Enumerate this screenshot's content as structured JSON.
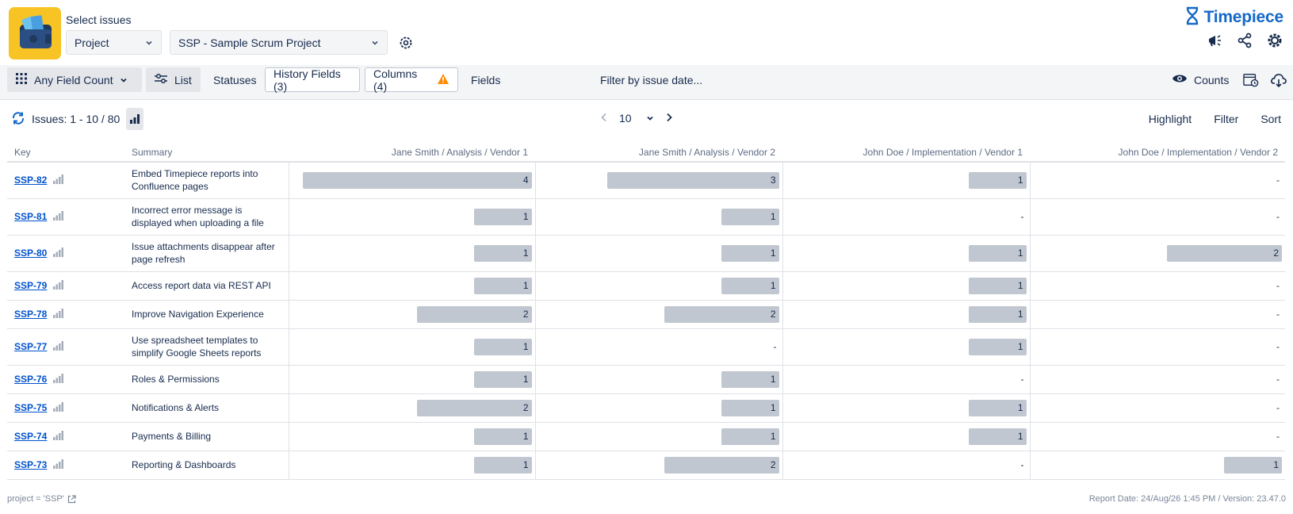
{
  "header": {
    "select_title": "Select issues",
    "scope_value": "Project",
    "project_value": "SSP - Sample Scrum Project",
    "brand": "Timepiece"
  },
  "toolbar": {
    "field_count": "Any Field Count",
    "list": "List",
    "statuses": "Statuses",
    "history_fields": "History Fields (3)",
    "columns": "Columns (4)",
    "fields": "Fields",
    "filter_date": "Filter by issue date...",
    "counts": "Counts"
  },
  "pager": {
    "issues_label": "Issues: 1 - 10 / 80",
    "page_size": "10",
    "highlight": "Highlight",
    "filter": "Filter",
    "sort": "Sort"
  },
  "table": {
    "headers": {
      "key": "Key",
      "summary": "Summary",
      "col1": "Jane Smith / Analysis / Vendor 1",
      "col2": "Jane Smith / Analysis / Vendor 2",
      "col3": "John Doe / Implementation / Vendor 1",
      "col4": "John Doe / Implementation / Vendor 2"
    },
    "max_value": 4,
    "rows": [
      {
        "key": "SSP-82",
        "summary": "Embed Timepiece reports into Confluence pages",
        "values": [
          "4",
          "3",
          "1",
          "-"
        ]
      },
      {
        "key": "SSP-81",
        "summary": "Incorrect error message is displayed when uploading a file",
        "values": [
          "1",
          "1",
          "-",
          "-"
        ]
      },
      {
        "key": "SSP-80",
        "summary": "Issue attachments disappear after page refresh",
        "values": [
          "1",
          "1",
          "1",
          "2"
        ]
      },
      {
        "key": "SSP-79",
        "summary": "Access report data via REST API",
        "values": [
          "1",
          "1",
          "1",
          "-"
        ]
      },
      {
        "key": "SSP-78",
        "summary": "Improve Navigation Experience",
        "values": [
          "2",
          "2",
          "1",
          "-"
        ]
      },
      {
        "key": "SSP-77",
        "summary": "Use spreadsheet templates to simplify Google Sheets reports",
        "values": [
          "1",
          "-",
          "1",
          "-"
        ]
      },
      {
        "key": "SSP-76",
        "summary": "Roles & Permissions",
        "values": [
          "1",
          "1",
          "-",
          "-"
        ]
      },
      {
        "key": "SSP-75",
        "summary": "Notifications & Alerts",
        "values": [
          "2",
          "1",
          "1",
          "-"
        ]
      },
      {
        "key": "SSP-74",
        "summary": "Payments & Billing",
        "values": [
          "1",
          "1",
          "1",
          "-"
        ]
      },
      {
        "key": "SSP-73",
        "summary": "Reporting & Dashboards",
        "values": [
          "1",
          "2",
          "-",
          "1"
        ]
      }
    ]
  },
  "footer": {
    "jql": "project = 'SSP'",
    "report_info": "Report Date: 24/Aug/26 1:45 PM / Version: 23.47.0"
  },
  "colors": {
    "brand_blue": "#1468c7",
    "logo_bg": "#f7c325",
    "bar_fill": "#c1c7d0",
    "warning": "#ff8b00",
    "link": "#0052cc"
  }
}
